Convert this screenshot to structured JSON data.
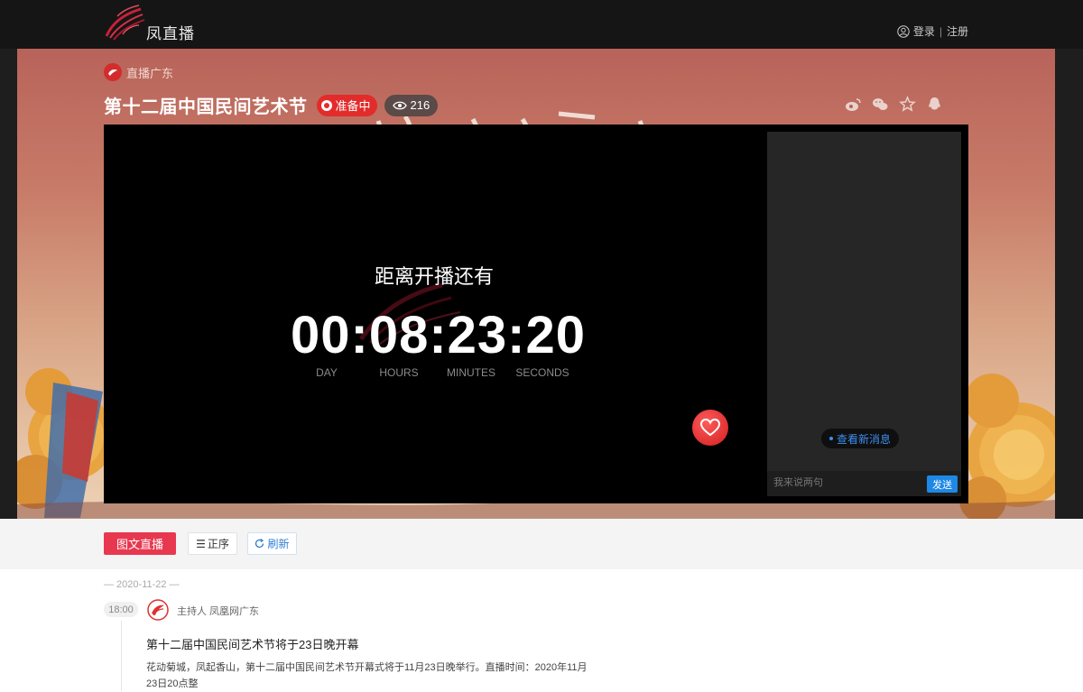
{
  "header": {
    "logo_text": "凤直播",
    "login_label": "登录",
    "register_label": "注册",
    "separator": "|"
  },
  "channel": {
    "label": "直播广东"
  },
  "live": {
    "title": "第十二届中国民间艺术节",
    "status": "准备中",
    "view_count": "216"
  },
  "share": {
    "icons": [
      "weibo-icon",
      "wechat-icon",
      "star-icon",
      "qq-icon"
    ]
  },
  "player": {
    "countdown_label": "距离开播还有",
    "countdown_time": "00:08:23:20",
    "units": [
      "DAY",
      "HOURS",
      "MINUTES",
      "SECONDS"
    ]
  },
  "chat": {
    "new_messages": "查看新消息",
    "input_placeholder": "我来说两句",
    "send_label": "发送"
  },
  "tabs": {
    "live_label": "图文直播",
    "sort_label": "正序",
    "refresh_label": "刷新"
  },
  "feed": {
    "date": "— 2020-11-22 —",
    "items": [
      {
        "time": "18:00",
        "host": "主持人 凤凰网广东",
        "title": "第十二届中国民间艺术节将于23日晚开幕",
        "body": "花动菊城，凤起香山，第十二届中国民间艺术节开幕式将于11月23日晚举行。直播时间：2020年11月23日20点整"
      }
    ]
  },
  "colors": {
    "accent_red": "#e8384f",
    "status_red": "#e32b2b",
    "link_blue": "#1e88e5",
    "topbar": "#151515"
  }
}
